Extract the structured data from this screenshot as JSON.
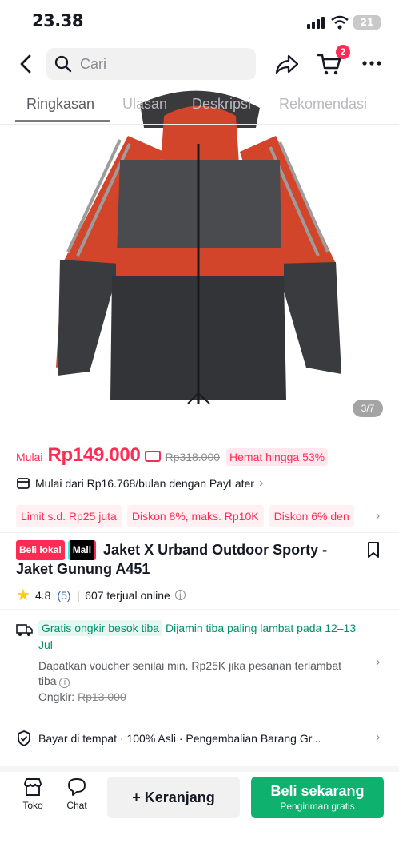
{
  "status_bar": {
    "time": "23.38",
    "battery": "21"
  },
  "header": {
    "search_placeholder": "Cari",
    "cart_count": "2"
  },
  "tabs": [
    {
      "label": "Ringkasan",
      "active": true
    },
    {
      "label": "Ulasan",
      "active": false
    },
    {
      "label": "Deskripsi",
      "active": false
    },
    {
      "label": "Rekomendasi",
      "active": false
    }
  ],
  "gallery": {
    "counter": "3/7"
  },
  "price": {
    "prefix": "Mulai",
    "current": "Rp149.000",
    "original": "Rp318.000",
    "discount": "Hemat hingga 53%"
  },
  "paylater": {
    "text": "Mulai dari Rp16.768/bulan dengan PayLater"
  },
  "promo_chips": [
    "Limit s.d. Rp25 juta",
    "Diskon 8%, maks. Rp10K",
    "Diskon 6% den"
  ],
  "product": {
    "badge_local": "Beli lokal",
    "badge_mall": "Mall",
    "title": "Jaket X Urband Outdoor Sporty - Jaket Gunung A451",
    "rating": "4.8",
    "reviews": "(5)",
    "sold": "607 terjual online"
  },
  "shipping": {
    "tag": "Gratis ongkir besok tiba",
    "guarantee": "Dijamin tiba paling lambat pada 12–13 Jul",
    "voucher": "Dapatkan voucher senilai min. Rp25K jika pesanan terlambat tiba",
    "ongkir_label": "Ongkir:",
    "ongkir_value": "Rp13.000"
  },
  "assurance": {
    "text": "Bayar di tempat · 100% Asli · Pengembalian Barang Gr..."
  },
  "bottom_bar": {
    "shop_label": "Toko",
    "chat_label": "Chat",
    "cart_button": "+ Keranjang",
    "buy_button": "Beli sekarang",
    "buy_sub": "Pengiriman gratis"
  },
  "colors": {
    "accent": "#fe2c55",
    "buy": "#0fb16e",
    "shipping": "#008f6e"
  }
}
